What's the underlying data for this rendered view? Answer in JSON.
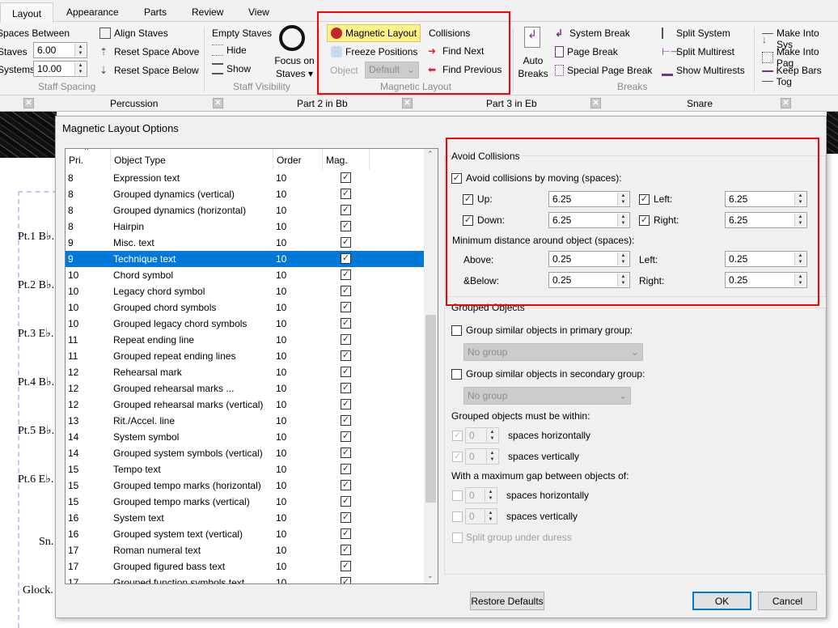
{
  "ribbon": {
    "tabs": [
      "Layout",
      "Appearance",
      "Parts",
      "Review",
      "View"
    ],
    "active_tab": "Layout",
    "staff_spacing": {
      "title": "Spaces Between",
      "staves_label": "Staves",
      "staves_value": "6.00",
      "systems_label": "Systems",
      "systems_value": "10.00",
      "align": "Align Staves",
      "reset_above": "Reset Space Above",
      "reset_below": "Reset Space Below",
      "group": "Staff Spacing"
    },
    "staff_visibility": {
      "title": "Empty Staves",
      "hide": "Hide",
      "show": "Show",
      "focus1": "Focus on",
      "focus2": "Staves",
      "group": "Staff Visibility"
    },
    "magnetic": {
      "magnetic_layout": "Magnetic Layout",
      "freeze": "Freeze Positions",
      "object_label": "Object",
      "object_value": "Default",
      "collisions": "Collisions",
      "find_next": "Find Next",
      "find_prev": "Find Previous",
      "group": "Magnetic Layout"
    },
    "breaks": {
      "auto1": "Auto",
      "auto2": "Breaks",
      "system": "System Break",
      "page": "Page Break",
      "special": "Special Page Break",
      "split_system": "Split System",
      "split_multirest": "Split Multirest",
      "show_multirests": "Show Multirests",
      "group": "Breaks"
    },
    "format": {
      "into_system": "Make Into Sys",
      "into_page": "Make Into Pag",
      "keep_bars": "Keep Bars Tog"
    }
  },
  "parts_tabs": [
    "Percussion",
    "Part 2 in Bb",
    "Part 3 in Eb",
    "Snare"
  ],
  "score": {
    "staves": [
      "Pt.1 B♭.",
      "Pt.2 B♭.",
      "Pt.3 E♭.",
      "Pt.4 B♭.",
      "Pt.5 B♭.",
      "Pt.6 E♭.",
      "Sn.",
      "Glock."
    ]
  },
  "dialog": {
    "title": "Magnetic Layout Options",
    "columns": [
      "Pri.",
      "Object Type",
      "Order",
      "Mag."
    ],
    "rows": [
      [
        "8",
        "Expression text",
        "10",
        true
      ],
      [
        "8",
        "Grouped dynamics (vertical)",
        "10",
        true
      ],
      [
        "8",
        "Grouped dynamics (horizontal)",
        "10",
        true
      ],
      [
        "8",
        "Hairpin",
        "10",
        true
      ],
      [
        "9",
        "Misc. text",
        "10",
        true
      ],
      [
        "9",
        "Technique text",
        "10",
        true
      ],
      [
        "10",
        "Chord symbol",
        "10",
        true
      ],
      [
        "10",
        "Legacy chord symbol",
        "10",
        true
      ],
      [
        "10",
        "Grouped chord symbols",
        "10",
        true
      ],
      [
        "10",
        "Grouped legacy chord symbols",
        "10",
        true
      ],
      [
        "11",
        "Repeat ending line",
        "10",
        true
      ],
      [
        "11",
        "Grouped repeat ending lines",
        "10",
        true
      ],
      [
        "12",
        "Rehearsal mark",
        "10",
        true
      ],
      [
        "12",
        "Grouped rehearsal marks ...",
        "10",
        true
      ],
      [
        "12",
        "Grouped rehearsal marks (vertical)",
        "10",
        true
      ],
      [
        "13",
        "Rit./Accel. line",
        "10",
        true
      ],
      [
        "14",
        "System symbol",
        "10",
        true
      ],
      [
        "14",
        "Grouped system symbols (vertical)",
        "10",
        true
      ],
      [
        "15",
        "Tempo text",
        "10",
        true
      ],
      [
        "15",
        "Grouped tempo marks (horizontal)",
        "10",
        true
      ],
      [
        "15",
        "Grouped tempo marks (vertical)",
        "10",
        true
      ],
      [
        "16",
        "System text",
        "10",
        true
      ],
      [
        "16",
        "Grouped system text (vertical)",
        "10",
        true
      ],
      [
        "17",
        "Roman numeral text",
        "10",
        true
      ],
      [
        "17",
        "Grouped figured bass text",
        "10",
        true
      ],
      [
        "17",
        "Grouped function symbols text",
        "10",
        true
      ]
    ],
    "selected_row": 5,
    "avoid": {
      "title": "Avoid Collisions",
      "moving": "Avoid collisions by moving (spaces):",
      "up": "Up:",
      "up_v": "6.25",
      "down": "Down:",
      "down_v": "6.25",
      "left": "Left:",
      "left_v": "6.25",
      "right": "Right:",
      "right_v": "6.25",
      "min": "Minimum distance around object (spaces):",
      "above": "Above:",
      "above_v": "0.25",
      "below": "&Below:",
      "below_v": "0.25",
      "mleft": "Left:",
      "mleft_v": "0.25",
      "mright": "Right:",
      "mright_v": "0.25"
    },
    "grouped": {
      "title": "Grouped Objects",
      "primary": "Group similar objects in primary group:",
      "primary_v": "No group",
      "secondary": "Group similar objects in secondary group:",
      "secondary_v": "No group",
      "within": "Grouped objects must be within:",
      "h": "spaces horizontally",
      "v": "spaces vertically",
      "h_v": "0",
      "v_v": "0",
      "gap": "With a maximum gap between objects of:",
      "gh": "spaces horizontally",
      "gv": "spaces vertically",
      "gh_v": "0",
      "gv_v": "0",
      "split": "Split group under duress"
    },
    "restore": "Restore Defaults",
    "ok": "OK",
    "cancel": "Cancel"
  },
  "colors": {
    "accent": "#0078d7",
    "highlight": "#ff0000",
    "magnet_active": "#fcf28a"
  }
}
